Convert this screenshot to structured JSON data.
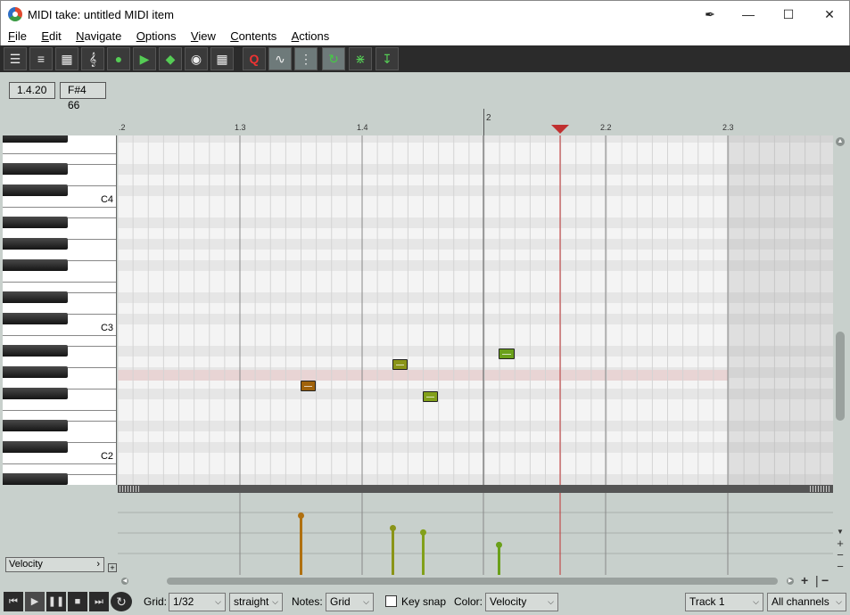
{
  "window": {
    "title": "MIDI take: untitled MIDI item"
  },
  "menu": [
    {
      "label": "File",
      "u": "F",
      "rest": "ile"
    },
    {
      "label": "Edit",
      "u": "E",
      "rest": "dit"
    },
    {
      "label": "Navigate",
      "u": "N",
      "rest": "avigate"
    },
    {
      "label": "Options",
      "u": "O",
      "rest": "ptions"
    },
    {
      "label": "View",
      "u": "V",
      "rest": "iew"
    },
    {
      "label": "Contents",
      "u": "C",
      "rest": "ontents"
    },
    {
      "label": "Actions",
      "u": "A",
      "rest": "ctions"
    }
  ],
  "toolbar_icons": [
    "piano-roll-view-icon",
    "named-notes-view-icon",
    "event-list-view-icon",
    "notation-view-icon",
    "insert-note-icon",
    "play-note-icon",
    "draw-note-icon",
    "paint-icon",
    "step-input-icon",
    "quantize-icon",
    "cc-curve-icon",
    "grid-icon",
    "loop-icon",
    "footprint-icon",
    "export-icon"
  ],
  "info": {
    "position": "1.4.20",
    "note": "F#4  66"
  },
  "ruler": {
    "labels": [
      ".2",
      "1.3",
      "1.4",
      "2",
      "2.2",
      "2.3"
    ]
  },
  "keyboard": {
    "labels": [
      "C4",
      "C3",
      "C2"
    ]
  },
  "notes": [
    {
      "pitch": "F#2",
      "color": "#a0620a"
    },
    {
      "pitch": "G#2",
      "color": "#8a9418"
    },
    {
      "pitch": "E2",
      "color": "#82a01a"
    },
    {
      "pitch": "A#2",
      "color": "#6aa01a"
    }
  ],
  "velocity": [
    {
      "value": 0.95,
      "color": "#b07010"
    },
    {
      "value": 0.75,
      "color": "#8a9418"
    },
    {
      "value": 0.68,
      "color": "#82a01a"
    },
    {
      "value": 0.48,
      "color": "#6aa01a"
    }
  ],
  "lane": {
    "label": "Velocity"
  },
  "bottom": {
    "grid_label": "Grid:",
    "grid_value": "1/32",
    "swing_value": "straight",
    "notes_label": "Notes:",
    "notes_value": "Grid",
    "keysnap_label": "Key snap",
    "color_label": "Color:",
    "color_value": "Velocity",
    "track_value": "Track 1",
    "channel_value": "All channels"
  },
  "colors": {
    "playhead": "#c03030",
    "highlight_row": "#e8d4d4"
  }
}
